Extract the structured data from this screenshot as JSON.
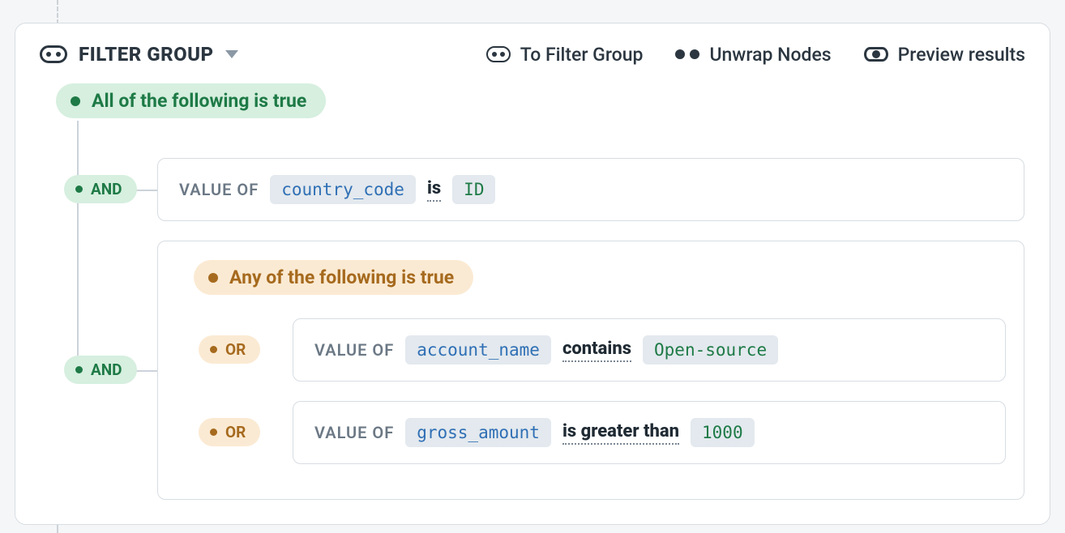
{
  "header": {
    "title": "FILTER GROUP",
    "actions": {
      "to_filter_group": "To Filter Group",
      "unwrap_nodes": "Unwrap Nodes",
      "preview": "Preview results"
    }
  },
  "group": {
    "all_label": "All of the following is true",
    "and_label": "AND",
    "conditions": [
      {
        "value_of": "VALUE OF",
        "field": "country_code",
        "op": "is",
        "value": "ID"
      }
    ],
    "any_group": {
      "any_label": "Any of the following is true",
      "or_label": "OR",
      "conditions": [
        {
          "value_of": "VALUE OF",
          "field": "account_name",
          "op": "contains",
          "value": "Open-source"
        },
        {
          "value_of": "VALUE OF",
          "field": "gross_amount",
          "op": "is greater than",
          "value": "1000"
        }
      ]
    }
  }
}
